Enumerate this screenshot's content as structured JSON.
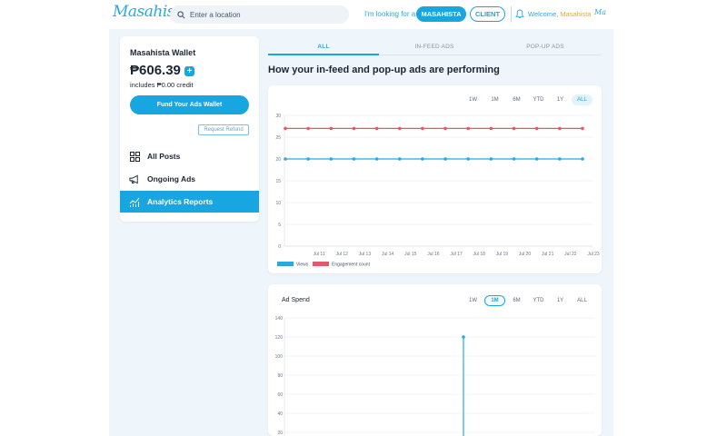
{
  "header": {
    "logo": "Masahista",
    "search_placeholder": "Enter a location",
    "looking_for": "I'm looking for a",
    "masahista_button": "MASAHISTA",
    "client_button": "CLIENT",
    "welcome_text": "Welcome, ",
    "welcome_name": "Masahista",
    "avatar_text": "Ma"
  },
  "sidebar": {
    "wallet_title": "Masahista Wallet",
    "wallet_amount": "₱606.39",
    "credit_note": "includes ₱0.00 credit",
    "fund_button": "Fund Your Ads Wallet",
    "refund_button": "Request Refund",
    "items": [
      {
        "label": "All Posts",
        "icon": "grid-icon"
      },
      {
        "label": "Ongoing Ads",
        "icon": "megaphone-icon"
      },
      {
        "label": "Analytics Reports",
        "icon": "chart-icon",
        "active": true
      }
    ]
  },
  "tabs": [
    {
      "label": "ALL",
      "active": true
    },
    {
      "label": "IN-FEED ADS"
    },
    {
      "label": "POP-UP ADS"
    }
  ],
  "heading": "How your in-feed and pop-up ads are performing",
  "colors": {
    "accent": "#17a6e0",
    "views": "#29a9e1",
    "engagement": "#e05a6b"
  },
  "chart1": {
    "ranges": [
      "1W",
      "1M",
      "6M",
      "YTD",
      "1Y",
      "ALL"
    ],
    "selected_range": "ALL",
    "legend": [
      "Views",
      "Engagement count"
    ]
  },
  "chart2": {
    "title": "Ad Spend",
    "ranges": [
      "1W",
      "1M",
      "6M",
      "YTD",
      "1Y",
      "ALL"
    ],
    "selected_range": "1M"
  },
  "chart_data": [
    {
      "type": "line",
      "title": "",
      "xlabel": "",
      "ylabel": "",
      "ylim": [
        0,
        30
      ],
      "yticks": [
        0,
        5,
        10,
        15,
        20,
        25,
        30
      ],
      "xticks": [
        "Jul 11",
        "Jul 12",
        "Jul 13",
        "Jul 14",
        "Jul 15",
        "Jul 16",
        "Jul 17",
        "Jul 18",
        "Jul 19",
        "Jul 20",
        "Jul 21",
        "Jul 22",
        "Jul 23"
      ],
      "x": [
        "Jul 10",
        "Jul 11",
        "Jul 12",
        "Jul 13",
        "Jul 14",
        "Jul 15",
        "Jul 16",
        "Jul 17",
        "Jul 18",
        "Jul 19",
        "Jul 20",
        "Jul 21",
        "Jul 22",
        "Jul 23"
      ],
      "series": [
        {
          "name": "Views",
          "values": [
            20,
            20,
            20,
            20,
            20,
            20,
            20,
            20,
            20,
            20,
            20,
            20,
            20,
            20
          ]
        },
        {
          "name": "Engagement count",
          "values": [
            27,
            27,
            27,
            27,
            27,
            27,
            27,
            27,
            27,
            27,
            27,
            27,
            27,
            27
          ]
        }
      ],
      "grid": true,
      "legend_position": "bottom-left"
    },
    {
      "type": "line",
      "title": "Ad Spend",
      "ylim": [
        0,
        140
      ],
      "yticks": [
        20,
        40,
        60,
        80,
        100,
        120,
        140
      ],
      "points": [
        {
          "y": 120
        }
      ],
      "grid": true
    }
  ]
}
